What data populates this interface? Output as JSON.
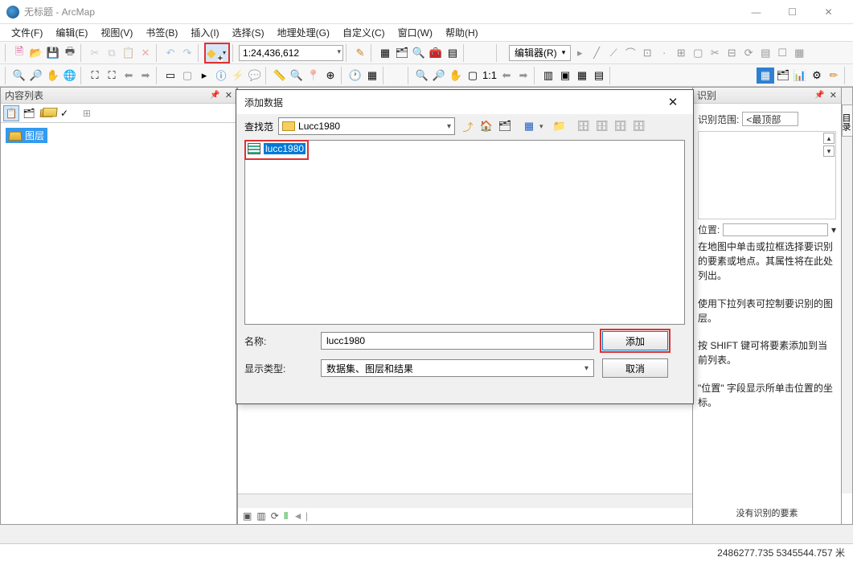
{
  "titlebar": {
    "title": "无标题 - ArcMap"
  },
  "menubar": {
    "items": [
      "文件(F)",
      "编辑(E)",
      "视图(V)",
      "书签(B)",
      "插入(I)",
      "选择(S)",
      "地理处理(G)",
      "自定义(C)",
      "窗口(W)",
      "帮助(H)"
    ]
  },
  "toolbar": {
    "scale": "1:24,436,612",
    "editor_label": "编辑器(R)"
  },
  "toc": {
    "title": "内容列表",
    "root_label": "图层"
  },
  "identify": {
    "title": "识别",
    "range_label": "识别范围:",
    "range_value": "<最顶部",
    "location_label": "位置:",
    "help_lines": [
      "在地图中单击或拉框选择要识别的要素或地点。其属性将在此处列出。",
      "使用下拉列表可控制要识别的图层。",
      "按 SHIFT 键可将要素添加到当前列表。",
      "\"位置\" 字段显示所单击位置的坐标。"
    ],
    "no_result": "没有识别的要素"
  },
  "right_tab": "目录",
  "statusbar": {
    "coords": "2486277.735  5345544.757 米"
  },
  "dialog": {
    "title": "添加数据",
    "lookin_label": "查找范",
    "folder_name": "Lucc1980",
    "list_item": "lucc1980",
    "name_label": "名称:",
    "name_value": "lucc1980",
    "type_label": "显示类型:",
    "type_value": "数据集、图层和结果",
    "btn_add": "添加",
    "btn_cancel": "取消"
  }
}
